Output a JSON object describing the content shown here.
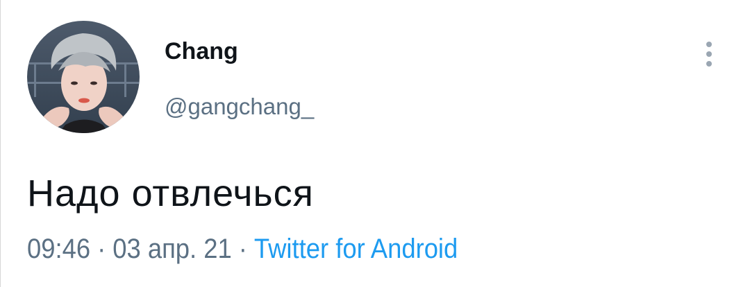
{
  "tweet": {
    "author": {
      "display_name": "Chang",
      "handle": "@gangchang_",
      "avatar_icon": "profile-photo-avatar"
    },
    "more_icon": "more-vertical-icon",
    "text": "Надо отвлечься",
    "meta": {
      "time": "09:46",
      "date": "03 апр. 21",
      "separator": "·",
      "source": "Twitter for Android"
    },
    "colors": {
      "text_primary": "#0f1419",
      "text_secondary": "#5b7083",
      "link": "#1d9bf0"
    }
  }
}
